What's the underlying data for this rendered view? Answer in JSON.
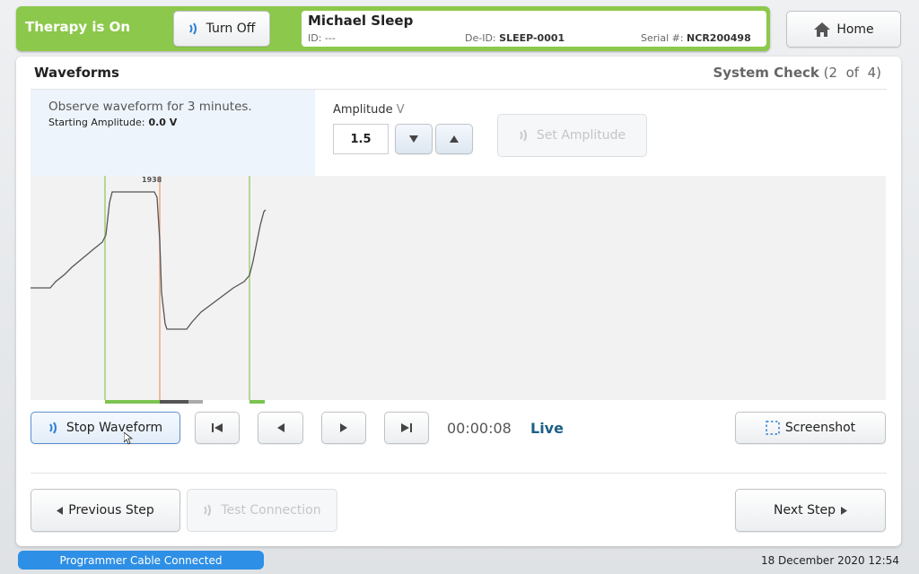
{
  "header": {
    "therapy_status": "Therapy is On",
    "turn_off_label": "Turn Off",
    "home_label": "Home"
  },
  "patient": {
    "name": "Michael Sleep",
    "id_label": "ID:",
    "id_value": "---",
    "deid_label": "De-ID:",
    "deid_value": "SLEEP-0001",
    "serial_label": "Serial #:",
    "serial_value": "NCR200498"
  },
  "panel": {
    "title": "Waveforms",
    "step_name": "System Check",
    "step_progress": "(2  of  4)"
  },
  "instructions": {
    "main": "Observe waveform for 3 minutes.",
    "starting_label": "Starting Amplitude:",
    "starting_value": "0.0 V"
  },
  "amplitude": {
    "label": "Amplitude",
    "unit": "V",
    "value": "1.5",
    "set_label": "Set Amplitude"
  },
  "waveform": {
    "marker_label": "1938"
  },
  "controls": {
    "stop_label": "Stop Waveform",
    "timer": "00:00:08",
    "live_label": "Live",
    "screenshot_label": "Screenshot"
  },
  "footer_nav": {
    "previous_label": "Previous Step",
    "test_connection_label": "Test Connection",
    "next_label": "Next Step"
  },
  "statusbar": {
    "cable_status": "Programmer Cable Connected",
    "datetime": "18 December 2020 12:54"
  },
  "colors": {
    "therapy_green": "#8cc84b",
    "status_blue": "#2e8fe6",
    "live_text": "#1d5f86"
  },
  "icons": [
    "wireless-icon",
    "home-icon",
    "triangle-down-icon",
    "triangle-up-icon",
    "skip-back-icon",
    "step-back-icon",
    "step-forward-icon",
    "skip-forward-icon",
    "screenshot-icon",
    "arrow-left-icon",
    "arrow-right-icon",
    "cursor-icon"
  ]
}
